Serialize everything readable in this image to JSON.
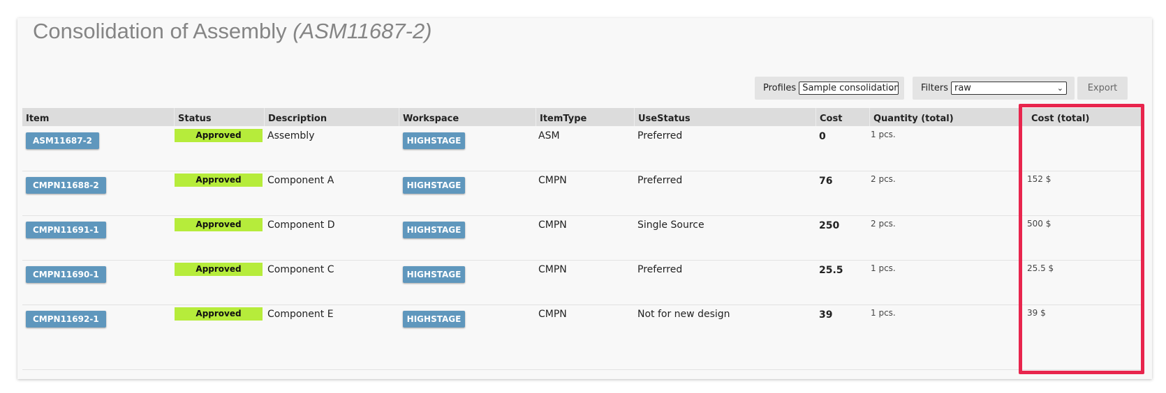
{
  "page": {
    "title_main": "Consolidation of Assembly",
    "title_code": "(ASM11687-2)"
  },
  "toolbar": {
    "profiles_label": "Profiles",
    "profiles_value": "Sample consolidation",
    "filters_label": "Filters",
    "filters_value": "raw",
    "export_label": "Export"
  },
  "table": {
    "columns": [
      "Item",
      "Status",
      "Description",
      "Workspace",
      "ItemType",
      "UseStatus",
      "Cost",
      "Quantity (total)",
      "Cost (total)"
    ],
    "rows": [
      {
        "item": "ASM11687-2",
        "status": "Approved",
        "description": "Assembly",
        "workspace": "HIGHSTAGE",
        "itemtype": "ASM",
        "usestatus": "Preferred",
        "cost": "0",
        "quantity": "1 pcs.",
        "cost_total": ""
      },
      {
        "item": "CMPN11688-2",
        "status": "Approved",
        "description": "Component A",
        "workspace": "HIGHSTAGE",
        "itemtype": "CMPN",
        "usestatus": "Preferred",
        "cost": "76",
        "quantity": "2 pcs.",
        "cost_total": "152 $"
      },
      {
        "item": "CMPN11691-1",
        "status": "Approved",
        "description": "Component D",
        "workspace": "HIGHSTAGE",
        "itemtype": "CMPN",
        "usestatus": "Single Source",
        "cost": "250",
        "quantity": "2 pcs.",
        "cost_total": "500 $"
      },
      {
        "item": "CMPN11690-1",
        "status": "Approved",
        "description": "Component C",
        "workspace": "HIGHSTAGE",
        "itemtype": "CMPN",
        "usestatus": "Preferred",
        "cost": "25.5",
        "quantity": "1 pcs.",
        "cost_total": "25.5 $"
      },
      {
        "item": "CMPN11692-1",
        "status": "Approved",
        "description": "Component E",
        "workspace": "HIGHSTAGE",
        "itemtype": "CMPN",
        "usestatus": "Not for new design",
        "cost": "39",
        "quantity": "1 pcs.",
        "cost_total": "39 $"
      }
    ]
  },
  "colors": {
    "button_blue": "#5f97bd",
    "status_green": "#b6ec3b",
    "highlight_red": "#e8254d",
    "header_gray": "#dcdcdc"
  },
  "icons": {
    "dropdown": "chevron-down-icon"
  }
}
